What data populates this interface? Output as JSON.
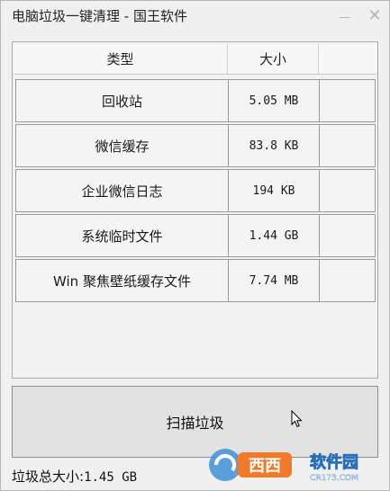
{
  "window": {
    "title": "电脑垃圾一键清理 - 国王软件",
    "minimize_symbol": "—",
    "close_symbol": "✕"
  },
  "table": {
    "columns": [
      "类型",
      "大小",
      ""
    ],
    "rows": [
      {
        "type": "回收站",
        "size": "5.05 MB"
      },
      {
        "type": "微信缓存",
        "size": "83.8 KB"
      },
      {
        "type": "企业微信日志",
        "size": "194 KB"
      },
      {
        "type": "系统临时文件",
        "size": "1.44 GB"
      },
      {
        "type": "Win 聚焦壁纸缓存文件",
        "size": "7.74 MB"
      }
    ]
  },
  "scan_button": {
    "label": "扫描垃圾"
  },
  "status": {
    "label": "垃圾总大小:",
    "value": "1.45 GB"
  },
  "watermark": {
    "brand": "西西",
    "site_name": "软件园",
    "domain": "CR173.COM"
  },
  "icons": {
    "cursor": "arrow-cursor-icon",
    "minimize": "minimize-icon",
    "close": "close-icon"
  }
}
